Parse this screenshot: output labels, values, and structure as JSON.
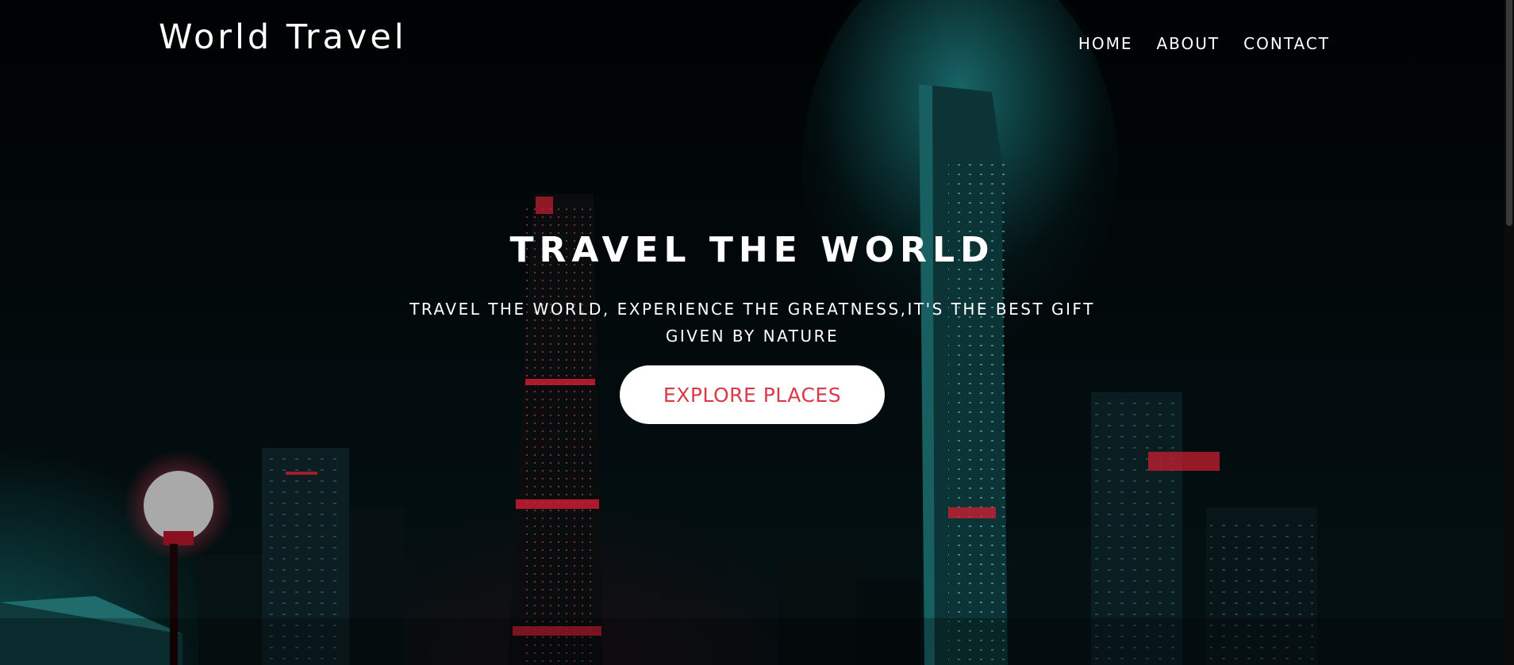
{
  "header": {
    "logo": "World Travel",
    "nav": [
      {
        "label": "HOME"
      },
      {
        "label": "ABOUT"
      },
      {
        "label": "CONTACT"
      }
    ]
  },
  "hero": {
    "title": "TRAVEL THE WORLD",
    "subtitle": "TRAVEL THE WORLD, EXPERIENCE THE GREATNESS,IT'S THE BEST GIFT GIVEN BY NATURE",
    "cta_label": "EXPLORE PLACES"
  },
  "colors": {
    "background": "#020405",
    "text": "#ffffff",
    "accent": "#d93a49",
    "button_bg": "#ffffff",
    "city_teal": "#1e8a8a",
    "city_red": "#c81e32"
  }
}
